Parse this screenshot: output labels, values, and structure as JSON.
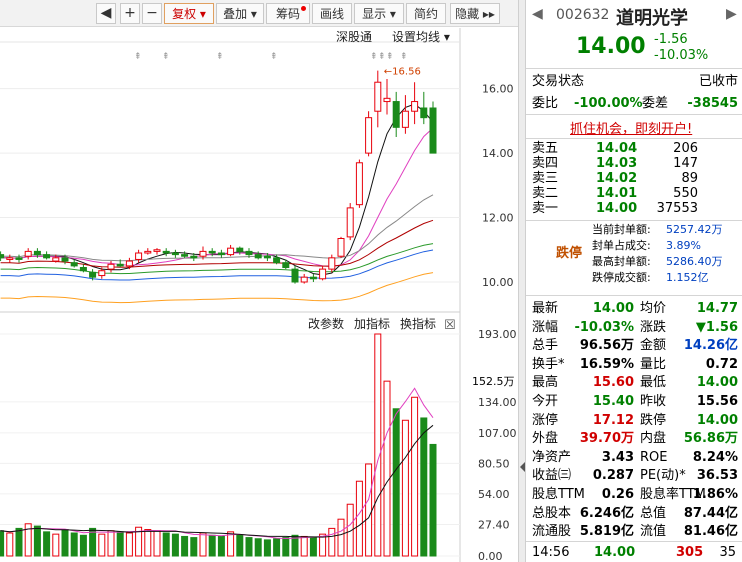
{
  "toolbar": {
    "items": [
      {
        "label": "◀",
        "kind": "sq"
      },
      {
        "label": "+",
        "kind": "sq"
      },
      {
        "label": "−",
        "kind": "sq"
      },
      {
        "label": "复权 ▾",
        "kind": "sel"
      },
      {
        "label": "叠加 ▾",
        "kind": "btn"
      },
      {
        "label": "筹码",
        "kind": "dot"
      },
      {
        "label": "画线",
        "kind": "btn"
      },
      {
        "label": "显示 ▾",
        "kind": "btn"
      },
      {
        "label": "简约",
        "kind": "btn"
      },
      {
        "label": "隐藏 ▸▸",
        "kind": "btn"
      }
    ]
  },
  "chart": {
    "top_links": [
      "深股通",
      "设置均线 ▾"
    ],
    "vol_links": [
      "改参数",
      "加指标",
      "换指标"
    ],
    "close_icon": "☒",
    "price_ticks": [
      "16.00",
      "14.00",
      "12.00",
      "10.00"
    ],
    "vol_ticks": [
      "193.00",
      "134.00",
      "107.00",
      "80.50",
      "54.00",
      "27.40",
      "0.00"
    ],
    "vol_tag": "152.5万",
    "high_marker": "←16.56",
    "colors": {
      "up": "#e8000b",
      "down": "#1a8a1a",
      "ma5": "#111111",
      "ma10": "#e040c0",
      "ma20": "#888888",
      "ma30": "#b00000",
      "ma60": "#2a9a2a",
      "ma120": "#2060e0",
      "ma250": "#ffa020"
    }
  },
  "chart_data": {
    "type": "candlestick",
    "candles": [
      [
        10.85,
        10.75,
        10.95,
        10.65,
        "down"
      ],
      [
        10.7,
        10.75,
        10.85,
        10.6,
        "up"
      ],
      [
        10.75,
        10.7,
        10.85,
        10.6,
        "down"
      ],
      [
        10.8,
        10.95,
        11.05,
        10.7,
        "up"
      ],
      [
        10.95,
        10.85,
        11.05,
        10.75,
        "down"
      ],
      [
        10.85,
        10.75,
        10.95,
        10.7,
        "down"
      ],
      [
        10.65,
        10.75,
        10.85,
        10.6,
        "up"
      ],
      [
        10.75,
        10.65,
        10.85,
        10.55,
        "down"
      ],
      [
        10.6,
        10.5,
        10.7,
        10.45,
        "down"
      ],
      [
        10.45,
        10.35,
        10.55,
        10.3,
        "down"
      ],
      [
        10.3,
        10.15,
        10.4,
        10.05,
        "down"
      ],
      [
        10.2,
        10.35,
        10.45,
        10.1,
        "up"
      ],
      [
        10.4,
        10.55,
        10.65,
        10.3,
        "up"
      ],
      [
        10.55,
        10.5,
        10.7,
        10.45,
        "down"
      ],
      [
        10.5,
        10.65,
        10.75,
        10.4,
        "up"
      ],
      [
        10.7,
        10.9,
        11.0,
        10.6,
        "up"
      ],
      [
        10.9,
        10.95,
        11.05,
        10.85,
        "up"
      ],
      [
        10.95,
        11.0,
        11.05,
        10.85,
        "up"
      ],
      [
        10.95,
        10.9,
        11.05,
        10.8,
        "down"
      ],
      [
        10.9,
        10.85,
        11.0,
        10.75,
        "down"
      ],
      [
        10.85,
        10.8,
        10.95,
        10.75,
        "down"
      ],
      [
        10.8,
        10.75,
        10.9,
        10.65,
        "down"
      ],
      [
        10.8,
        10.95,
        11.1,
        10.7,
        "up"
      ],
      [
        10.95,
        10.9,
        11.05,
        10.8,
        "down"
      ],
      [
        10.9,
        10.85,
        11.0,
        10.75,
        "down"
      ],
      [
        10.85,
        11.05,
        11.15,
        10.8,
        "up"
      ],
      [
        11.05,
        10.95,
        11.1,
        10.85,
        "down"
      ],
      [
        10.95,
        10.85,
        11.05,
        10.75,
        "down"
      ],
      [
        10.85,
        10.75,
        10.95,
        10.7,
        "down"
      ],
      [
        10.8,
        10.75,
        10.9,
        10.65,
        "down"
      ],
      [
        10.75,
        10.6,
        10.85,
        10.55,
        "down"
      ],
      [
        10.6,
        10.45,
        10.7,
        10.4,
        "down"
      ],
      [
        10.4,
        10.0,
        10.5,
        9.95,
        "down"
      ],
      [
        10.0,
        10.15,
        10.25,
        9.95,
        "up"
      ],
      [
        10.15,
        10.1,
        10.25,
        10.0,
        "down"
      ],
      [
        10.1,
        10.4,
        10.5,
        10.05,
        "up"
      ],
      [
        10.4,
        10.75,
        10.85,
        10.3,
        "up"
      ],
      [
        10.8,
        11.35,
        11.4,
        10.75,
        "up"
      ],
      [
        11.4,
        12.3,
        12.45,
        11.3,
        "up"
      ],
      [
        12.4,
        13.7,
        13.8,
        12.3,
        "up"
      ],
      [
        14.0,
        15.1,
        15.3,
        13.9,
        "up"
      ],
      [
        15.3,
        16.2,
        16.56,
        14.8,
        "up"
      ],
      [
        15.6,
        15.7,
        16.3,
        15.2,
        "up"
      ],
      [
        15.6,
        14.8,
        15.9,
        14.5,
        "down"
      ],
      [
        14.8,
        15.3,
        15.8,
        14.6,
        "up"
      ],
      [
        15.3,
        15.6,
        16.2,
        14.9,
        "up"
      ],
      [
        15.4,
        15.1,
        15.9,
        14.9,
        "down"
      ],
      [
        15.4,
        14.0,
        15.6,
        14.0,
        "down"
      ]
    ],
    "volumes": [
      [
        22,
        "down"
      ],
      [
        20,
        "up"
      ],
      [
        24,
        "down"
      ],
      [
        28,
        "up"
      ],
      [
        26,
        "down"
      ],
      [
        21,
        "down"
      ],
      [
        19,
        "up"
      ],
      [
        23,
        "down"
      ],
      [
        20,
        "down"
      ],
      [
        18,
        "down"
      ],
      [
        24,
        "down"
      ],
      [
        19,
        "up"
      ],
      [
        22,
        "up"
      ],
      [
        21,
        "down"
      ],
      [
        20,
        "up"
      ],
      [
        25,
        "up"
      ],
      [
        23,
        "up"
      ],
      [
        22,
        "up"
      ],
      [
        20,
        "down"
      ],
      [
        19,
        "down"
      ],
      [
        17,
        "down"
      ],
      [
        16,
        "down"
      ],
      [
        20,
        "up"
      ],
      [
        18,
        "down"
      ],
      [
        17,
        "down"
      ],
      [
        21,
        "up"
      ],
      [
        18,
        "down"
      ],
      [
        16,
        "down"
      ],
      [
        15,
        "down"
      ],
      [
        14,
        "down"
      ],
      [
        15,
        "down"
      ],
      [
        16,
        "down"
      ],
      [
        18,
        "down"
      ],
      [
        17,
        "up"
      ],
      [
        16,
        "down"
      ],
      [
        19,
        "up"
      ],
      [
        24,
        "up"
      ],
      [
        32,
        "up"
      ],
      [
        45,
        "up"
      ],
      [
        65,
        "up"
      ],
      [
        80,
        "up"
      ],
      [
        193,
        "up"
      ],
      [
        152,
        "up"
      ],
      [
        128,
        "down"
      ],
      [
        118,
        "up"
      ],
      [
        138,
        "up"
      ],
      [
        120,
        "down"
      ],
      [
        97,
        "down"
      ]
    ],
    "price_range": [
      9.1,
      17.2
    ],
    "volume_range": [
      0,
      193
    ]
  },
  "quote": {
    "code": "002632",
    "name": "道明光学",
    "price": "14.00",
    "change": "-1.56",
    "change_pct": "-10.03%",
    "trade_status_label": "交易状态",
    "trade_status_value": "已收市",
    "webi_label": "委比",
    "webi_value": "-100.00%",
    "weicha_label": "委差",
    "weicha_value": "-38545",
    "promo": "抓住机会，即刻开户!"
  },
  "order_book": [
    {
      "label": "卖五",
      "price": "14.04",
      "vol": "206"
    },
    {
      "label": "卖四",
      "price": "14.03",
      "vol": "147"
    },
    {
      "label": "卖三",
      "price": "14.02",
      "vol": "89"
    },
    {
      "label": "卖二",
      "price": "14.01",
      "vol": "550"
    },
    {
      "label": "卖一",
      "price": "14.00",
      "vol": "37553"
    }
  ],
  "limit": {
    "badge": "跌停",
    "items": [
      {
        "label": "当前封单额:",
        "value": "5257.42万"
      },
      {
        "label": "封单占成交:",
        "value": "3.89%"
      },
      {
        "label": "最高封单额:",
        "value": "5286.40万"
      },
      {
        "label": "跌停成交额:",
        "value": "1.152亿"
      }
    ]
  },
  "stats": [
    {
      "l1": "最新",
      "v1": "14.00",
      "c1": "green",
      "l2": "均价",
      "v2": "14.77",
      "c2": "green"
    },
    {
      "l1": "涨幅",
      "v1": "-10.03%",
      "c1": "green",
      "l2": "涨跌",
      "v2": "▼1.56",
      "c2": "green"
    },
    {
      "l1": "总手",
      "v1": "96.56万",
      "c1": "black",
      "l2": "金额",
      "v2": "14.26亿",
      "c2": "blue"
    },
    {
      "l1": "换手*",
      "v1": "16.59%",
      "c1": "black",
      "l2": "量比",
      "v2": "0.72",
      "c2": "black"
    },
    {
      "l1": "最高",
      "v1": "15.60",
      "c1": "red",
      "l2": "最低",
      "v2": "14.00",
      "c2": "green"
    },
    {
      "l1": "今开",
      "v1": "15.40",
      "c1": "green",
      "l2": "昨收",
      "v2": "15.56",
      "c2": "black"
    },
    {
      "l1": "涨停",
      "v1": "17.12",
      "c1": "red",
      "l2": "跌停",
      "v2": "14.00",
      "c2": "green"
    },
    {
      "l1": "外盘",
      "v1": "39.70万",
      "c1": "red",
      "l2": "内盘",
      "v2": "56.86万",
      "c2": "green"
    },
    {
      "l1": "净资产",
      "v1": "3.43",
      "c1": "black",
      "l2": "ROE",
      "v2": "8.24%",
      "c2": "black"
    },
    {
      "l1": "收益㈢",
      "v1": "0.287",
      "c1": "black",
      "l2": "PE(动)*",
      "v2": "36.53",
      "c2": "black"
    },
    {
      "l1": "股息TTM",
      "v1": "0.26",
      "c1": "black",
      "l2": "股息率TTM",
      "v2": "1.86%",
      "c2": "black"
    },
    {
      "l1": "总股本",
      "v1": "6.246亿",
      "c1": "black",
      "l2": "总值",
      "v2": "87.44亿",
      "c2": "black"
    },
    {
      "l1": "流通股",
      "v1": "5.819亿",
      "c1": "black",
      "l2": "流值",
      "v2": "81.46亿",
      "c2": "black"
    }
  ],
  "tick": {
    "time": "14:56",
    "price": "14.00",
    "vol": "305",
    "num": "35"
  }
}
